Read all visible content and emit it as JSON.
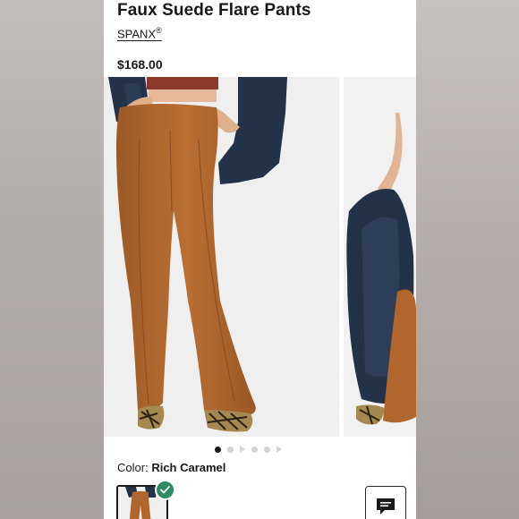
{
  "product": {
    "title": "Faux Suede Flare Pants",
    "brand": "SPANX",
    "brand_mark": "®",
    "price": "$168.00"
  },
  "carousel": {
    "image_count": 6,
    "active_index": 0
  },
  "color": {
    "label": "Color:",
    "value": "Rich Caramel",
    "selected_swatch": "Rich Caramel"
  },
  "colors": {
    "caramel": "#b0662c",
    "navy_blazer": "#243248",
    "check_green": "#2e8a63"
  },
  "icons": {
    "check": "check-icon",
    "chat": "chat-icon"
  }
}
